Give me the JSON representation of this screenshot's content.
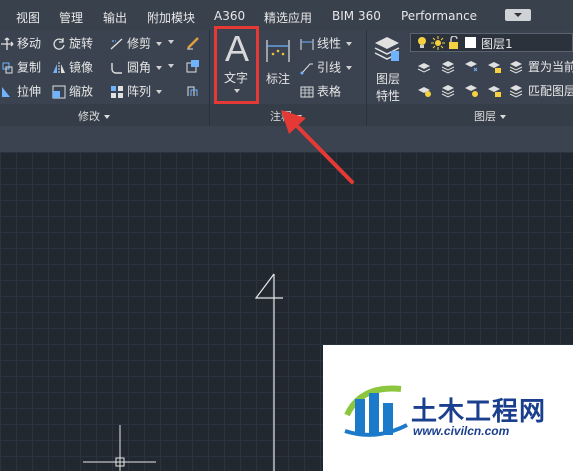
{
  "menu": {
    "items": [
      "视图",
      "管理",
      "输出",
      "附加模块",
      "A360",
      "精选应用",
      "BIM 360",
      "Performance"
    ]
  },
  "modify_panel": {
    "title": "修改",
    "tools": [
      "移动",
      "旋转",
      "修剪",
      "复制",
      "镜像",
      "圆角",
      "拉伸",
      "缩放",
      "阵列"
    ]
  },
  "annotation_panel": {
    "title": "注释",
    "text_tool": "文字",
    "text_icon": "A",
    "dimension_tool": "标注",
    "linear_tool": "线性",
    "leader_tool": "引线",
    "table_tool": "表格"
  },
  "layers_panel": {
    "title": "图层",
    "layer_properties_line1": "图层",
    "layer_properties_line2": "特性",
    "current_layer": "图层1",
    "set_current": "置为当前",
    "match_layer": "匹配图层"
  },
  "canvas": {
    "drawn_digit": "4"
  },
  "watermark": {
    "title": "土木工程网",
    "url": "www.civilcn.com"
  },
  "colors": {
    "highlight": "#e53935",
    "ribbon_bg": "#3a434f",
    "canvas_bg": "#212830",
    "watermark_blue": "#1b3f8f"
  }
}
